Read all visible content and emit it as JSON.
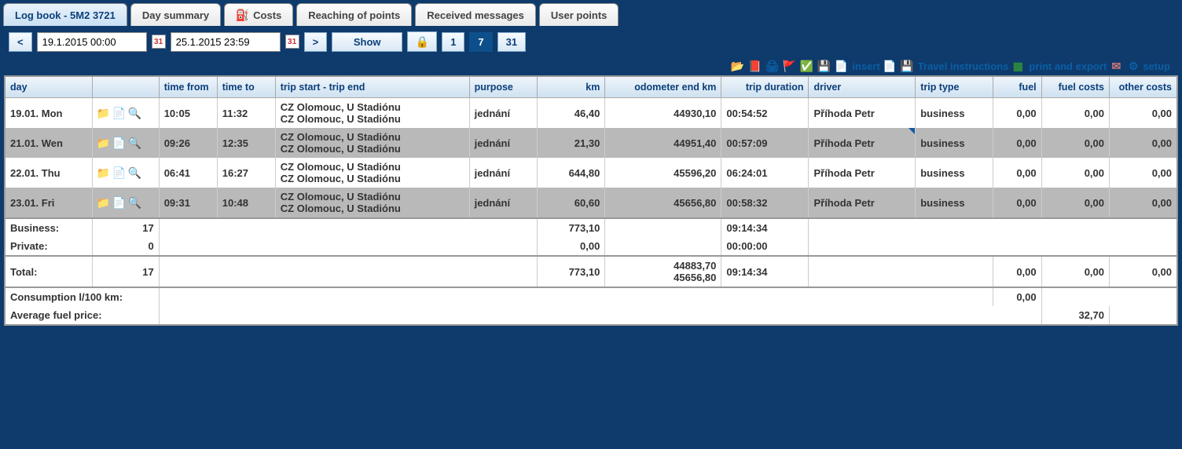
{
  "tabs": {
    "logbook": "Log book - 5M2 3721",
    "day_summary": "Day summary",
    "costs": "Costs",
    "reaching": "Reaching of points",
    "received": "Received messages",
    "user_points": "User points"
  },
  "controls": {
    "prev": "<",
    "next": ">",
    "date_from": "19.1.2015 00:00",
    "date_to": "25.1.2015 23:59",
    "cal_label": "31",
    "show": "Show",
    "range1": "1",
    "range7": "7",
    "range31": "31"
  },
  "toolbar": {
    "insert": "insert",
    "travel": "Travel instructions",
    "print": "print and export",
    "setup": "setup"
  },
  "headers": {
    "day": "day",
    "time_from": "time from",
    "time_to": "time to",
    "trip": "trip start - trip end",
    "purpose": "purpose",
    "km": "km",
    "odo": "odometer end km",
    "duration": "trip duration",
    "driver": "driver",
    "trip_type": "trip type",
    "fuel": "fuel",
    "fuel_costs": "fuel costs",
    "other_costs": "other costs"
  },
  "rows": [
    {
      "day": "19.01. Mon",
      "from": "10:05",
      "to": "11:32",
      "start": "CZ Olomouc, U Stadiónu",
      "end": "CZ Olomouc, U Stadiónu",
      "purpose": "jednání",
      "km": "46,40",
      "odo": "44930,10",
      "dur": "00:54:52",
      "driver": "Příhoda Petr",
      "type": "business",
      "fuel": "0,00",
      "fuel_costs": "0,00",
      "other": "0,00",
      "flag": false
    },
    {
      "day": "21.01. Wen",
      "from": "09:26",
      "to": "12:35",
      "start": "CZ Olomouc, U Stadiónu",
      "end": "CZ Olomouc, U Stadiónu",
      "purpose": "jednání",
      "km": "21,30",
      "odo": "44951,40",
      "dur": "00:57:09",
      "driver": "Příhoda Petr",
      "type": "business",
      "fuel": "0,00",
      "fuel_costs": "0,00",
      "other": "0,00",
      "flag": true
    },
    {
      "day": "22.01. Thu",
      "from": "06:41",
      "to": "16:27",
      "start": "CZ Olomouc, U Stadiónu",
      "end": "CZ Olomouc, U Stadiónu",
      "purpose": "jednání",
      "km": "644,80",
      "odo": "45596,20",
      "dur": "06:24:01",
      "driver": "Příhoda Petr",
      "type": "business",
      "fuel": "0,00",
      "fuel_costs": "0,00",
      "other": "0,00",
      "flag": false
    },
    {
      "day": "23.01. Fri",
      "from": "09:31",
      "to": "10:48",
      "start": "CZ Olomouc, U Stadiónu",
      "end": "CZ Olomouc, U Stadiónu",
      "purpose": "jednání",
      "km": "60,60",
      "odo": "45656,80",
      "dur": "00:58:32",
      "driver": "Příhoda Petr",
      "type": "business",
      "fuel": "0,00",
      "fuel_costs": "0,00",
      "other": "0,00",
      "flag": false
    }
  ],
  "summary": {
    "business_label": "Business:",
    "business_count": "17",
    "business_km": "773,10",
    "business_dur": "09:14:34",
    "private_label": "Private:",
    "private_count": "0",
    "private_km": "0,00",
    "private_dur": "00:00:00",
    "total_label": "Total:",
    "total_count": "17",
    "total_km": "773,10",
    "total_odo1": "44883,70",
    "total_odo2": "45656,80",
    "total_dur": "09:14:34",
    "total_fuel": "0,00",
    "total_fuel_costs": "0,00",
    "total_other": "0,00",
    "consumption_label": "Consumption l/100 km:",
    "consumption_val": "0,00",
    "avg_fuel_label": "Average fuel price:",
    "avg_fuel_val": "32,70"
  }
}
